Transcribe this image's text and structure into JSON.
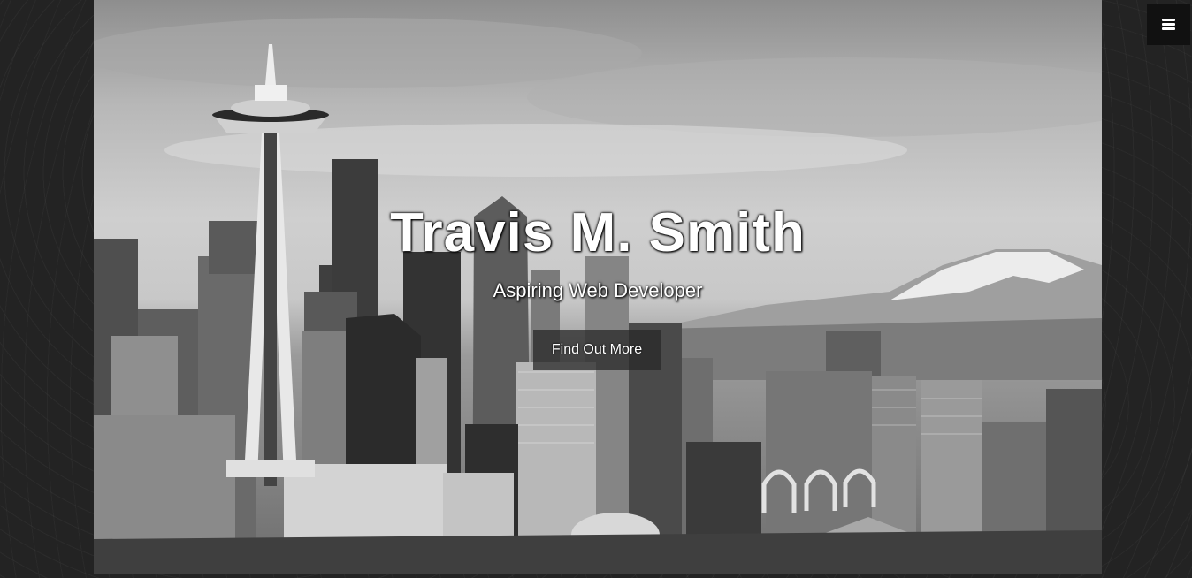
{
  "hero": {
    "title": "Travis M. Smith",
    "subtitle": "Aspiring Web Developer",
    "cta_label": "Find Out More",
    "background_icon": "city-skyline-photo"
  },
  "menu": {
    "icon": "hamburger-menu-icon"
  },
  "colors": {
    "page_background": "#232323",
    "menu_button_background": "#111111",
    "text": "#ffffff"
  }
}
